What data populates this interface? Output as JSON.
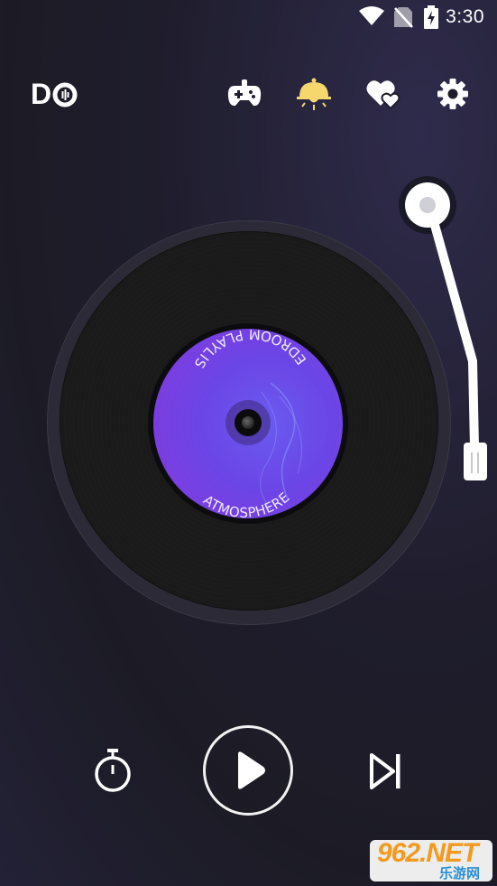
{
  "status_bar": {
    "time": "3:30",
    "icons": [
      "wifi-icon",
      "no-sim-icon",
      "battery-charging-icon"
    ]
  },
  "header": {
    "logo_text": "D",
    "icons": [
      "gamepad-icon",
      "sun-lamp-icon",
      "hearts-icon",
      "gear-icon"
    ],
    "accent_color": "#f5d76e"
  },
  "record": {
    "label_top_text": "BEDROOM  PLAYLIST",
    "label_bottom_text": "ATMOSPHERE",
    "label_color": "#6b45e6"
  },
  "controls": {
    "icons": [
      "timer-icon",
      "play-icon",
      "skip-next-icon"
    ]
  },
  "watermark": {
    "main": "962.NET",
    "sub": "乐游网"
  }
}
